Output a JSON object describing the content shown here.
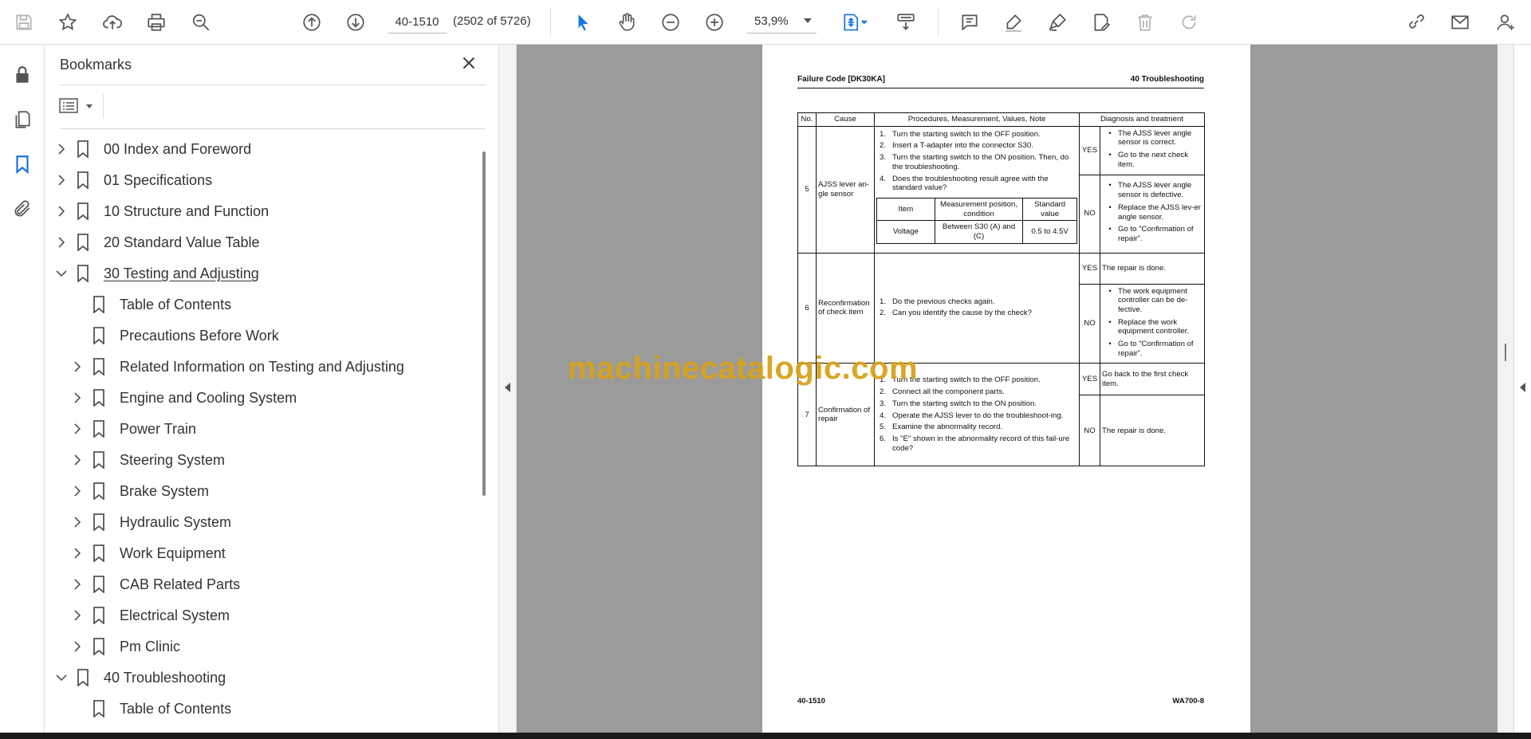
{
  "toolbar": {
    "page_number": "40-1510",
    "page_count": "(2502 of 5726)",
    "zoom": "53,9%"
  },
  "bookmarks": {
    "title": "Bookmarks",
    "items": [
      {
        "label": "00 Index and Foreword"
      },
      {
        "label": "01 Specifications"
      },
      {
        "label": "10 Structure and Function"
      },
      {
        "label": "20 Standard Value Table"
      },
      {
        "label": "30 Testing and Adjusting"
      },
      {
        "label": "Table of Contents"
      },
      {
        "label": "Precautions Before Work"
      },
      {
        "label": "Related Information on Testing and Adjusting"
      },
      {
        "label": "Engine and Cooling System"
      },
      {
        "label": "Power Train"
      },
      {
        "label": "Steering System"
      },
      {
        "label": "Brake System"
      },
      {
        "label": "Hydraulic System"
      },
      {
        "label": "Work Equipment"
      },
      {
        "label": "CAB Related Parts"
      },
      {
        "label": "Electrical System"
      },
      {
        "label": "Pm Clinic"
      },
      {
        "label": "40 Troubleshooting"
      },
      {
        "label": "Table of Contents"
      }
    ]
  },
  "document": {
    "header_left": "Failure Code [DK30KA]",
    "header_right": "40 Troubleshooting",
    "footer_left": "40-1510",
    "footer_right": "WA700-8",
    "watermark": "machinecatalogic.com",
    "table": {
      "headers": [
        "No.",
        "Cause",
        "Procedures, Measurement, Values, Note",
        "Diagnosis and treatment"
      ],
      "rows": [
        {
          "no": "5",
          "cause": "AJSS lever an-gle sensor",
          "steps": [
            {
              "n": "1.",
              "t": "Turn the starting switch to the OFF position."
            },
            {
              "n": "2.",
              "t": "Insert a T-adapter into the connector S30."
            },
            {
              "n": "3.",
              "t": "Turn the starting switch to the ON position. Then, do the troubleshooting."
            },
            {
              "n": "4.",
              "t": "Does the troubleshooting result agree with the standard value?"
            }
          ],
          "inner": {
            "h1": "Item",
            "h2": "Measurement position, condition",
            "h3": "Standard value",
            "r1": "Voltage",
            "r2": "Between S30 (A) and (C)",
            "r3": "0.5 to 4.5V"
          },
          "yes": "YES",
          "yes_items": [
            "The AJSS lever angle sensor is correct.",
            "Go to the next check item."
          ],
          "no_label": "NO",
          "no_items": [
            "The AJSS lever angle sensor is defective.",
            "Replace the AJSS lev-er angle sensor.",
            "Go to \"Confirmation of repair\"."
          ]
        },
        {
          "no": "6",
          "cause": "Reconfirmation of check item",
          "steps": [
            {
              "n": "1.",
              "t": "Do the previous checks again."
            },
            {
              "n": "2.",
              "t": "Can you identify the cause by the check?"
            }
          ],
          "yes": "YES",
          "yes_text": "The repair is done.",
          "no_label": "NO",
          "no_items": [
            "The work equipment controller can be de-fective.",
            "Replace the work equipment controller.",
            "Go to \"Confirmation of repair\"."
          ]
        },
        {
          "no": "7",
          "cause": "Confirmation of repair",
          "steps": [
            {
              "n": "1.",
              "t": "Turn the starting switch to the OFF position."
            },
            {
              "n": "2.",
              "t": "Connect all the component parts."
            },
            {
              "n": "3.",
              "t": "Turn the starting switch to the ON position."
            },
            {
              "n": "4.",
              "t": "Operate the AJSS lever to do the troubleshoot-ing."
            },
            {
              "n": "5.",
              "t": "Examine the abnormality record."
            },
            {
              "n": "6.",
              "t": "Is \"E\" shown in the abnormality record of this fail-ure code?"
            }
          ],
          "yes": "YES",
          "yes_text": "Go back to the first check item.",
          "no_label": "NO",
          "no_text": "The repair is done."
        }
      ]
    }
  },
  "icons": {
    "accent": "#1473e6",
    "icon_gray": "#555555",
    "disabled_gray": "#b3b3b3"
  }
}
